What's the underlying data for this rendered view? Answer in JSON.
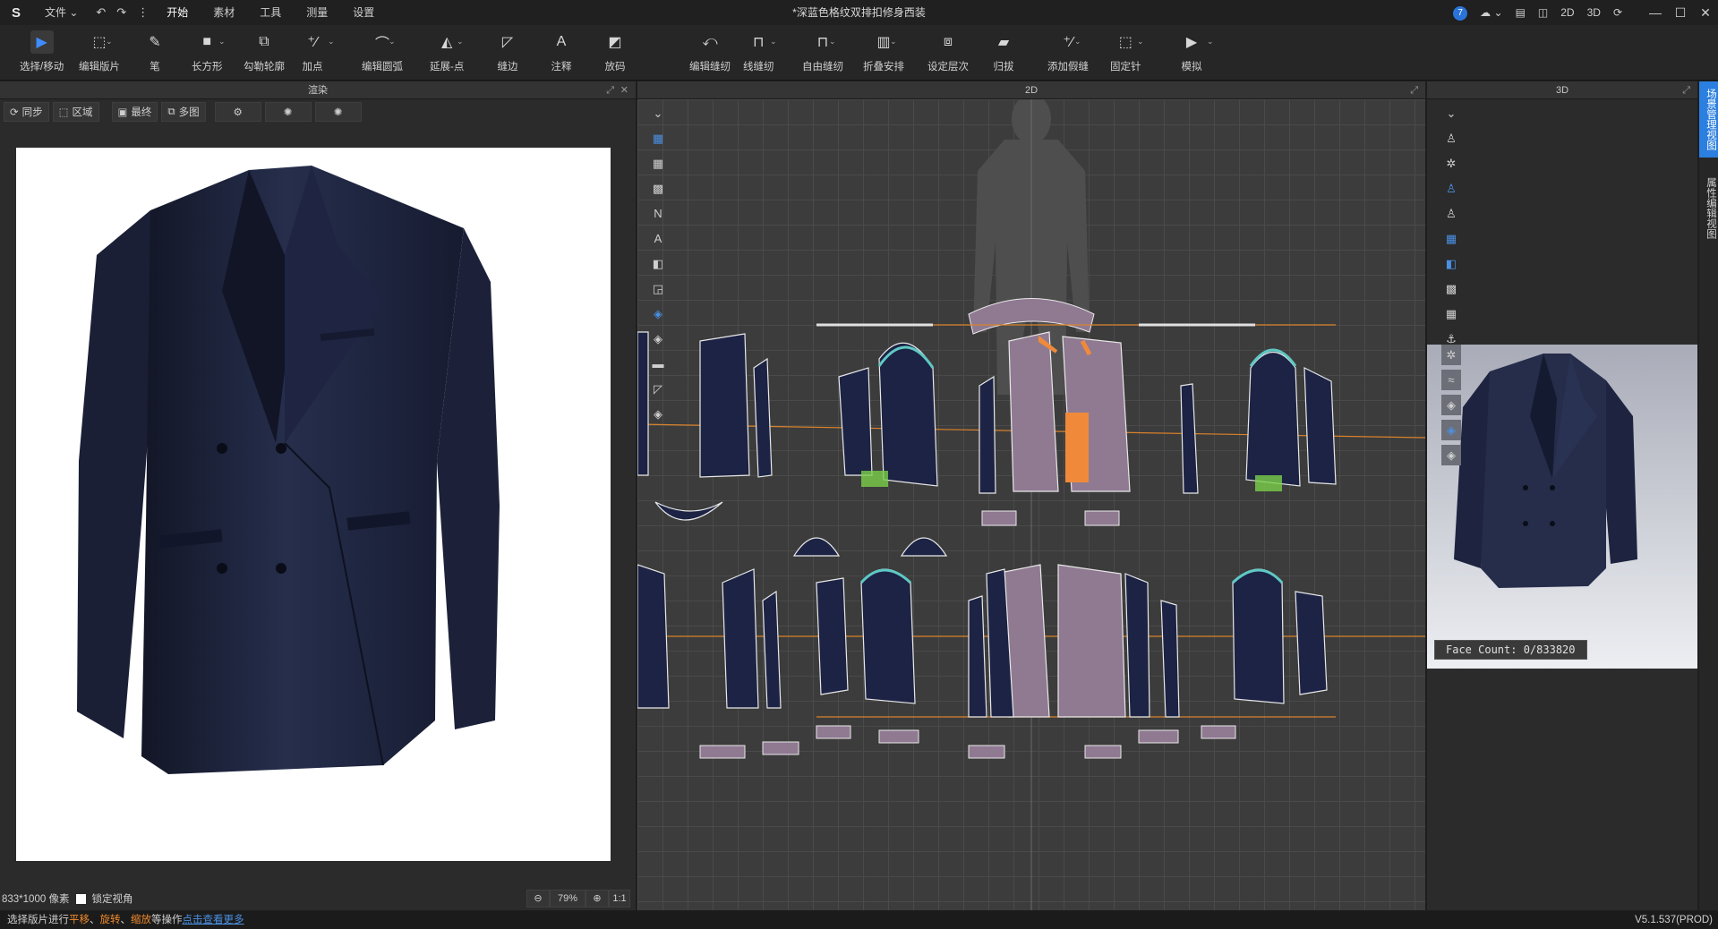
{
  "titlebar": {
    "logo": "S",
    "menu": [
      {
        "label": "文件 ⌄"
      },
      {
        "label": "开始",
        "active": true
      },
      {
        "label": "素材"
      },
      {
        "label": "工具"
      },
      {
        "label": "测量"
      },
      {
        "label": "设置"
      }
    ],
    "quick": [
      "↶",
      "↷",
      "⋮"
    ],
    "doc_title": "*深蓝色格纹双排扣修身西装",
    "right_items": [
      "7",
      "☁ ⌄",
      "▤",
      "◫",
      "2D",
      "3D",
      "⟳"
    ],
    "window_controls": [
      "—",
      "☐",
      "✕"
    ]
  },
  "toolbar": {
    "tools": [
      {
        "label": "选择/移动",
        "icon": "▶",
        "selected": true
      },
      {
        "label": "编辑版片",
        "icon": "⬚",
        "dd": true
      },
      {
        "label": "笔",
        "icon": "✎"
      },
      {
        "label": "长方形",
        "icon": "■",
        "dd": true
      },
      {
        "label": "勾勒轮廓",
        "icon": "⧉"
      },
      {
        "label": "加点",
        "icon": "⁺∕",
        "dd": true
      },
      {
        "label": "编辑圆弧",
        "icon": "⌒",
        "dd": true
      },
      {
        "label": "延展-点",
        "icon": "◭",
        "dd": true
      },
      {
        "label": "缝边",
        "icon": "◸"
      },
      {
        "label": "注释",
        "icon": "A"
      },
      {
        "label": "放码",
        "icon": "◩"
      },
      {
        "label": "编辑缝纫",
        "icon": "⤺"
      },
      {
        "label": "线缝纫",
        "icon": "⊓",
        "dd": true
      },
      {
        "label": "自由缝纫",
        "icon": "⊓",
        "dd": true
      },
      {
        "label": "折叠安排",
        "icon": "▥",
        "dd": true
      },
      {
        "label": "设定层次",
        "icon": "⧈"
      },
      {
        "label": "归拔",
        "icon": "▰"
      },
      {
        "label": "添加假缝",
        "icon": "⁺∕",
        "dd": true
      },
      {
        "label": "固定针",
        "icon": "⬚",
        "dd": true
      },
      {
        "label": "模拟",
        "icon": "▶",
        "dd": true
      }
    ]
  },
  "render_panel": {
    "title": "渲染",
    "buttons": [
      {
        "label": "同步",
        "icon": "⟳"
      },
      {
        "label": "区域",
        "icon": "⬚"
      },
      {
        "label": "最终",
        "icon": "▣"
      },
      {
        "label": "多图",
        "icon": "⧉"
      }
    ],
    "image_size": "833*1000 像素",
    "lock_label": "锁定视角",
    "zoom": "79%",
    "ratio": "1:1"
  },
  "panel_2d": {
    "title": "2D"
  },
  "panel_3d": {
    "title": "3D",
    "face_count": "Face Count: 0/833820"
  },
  "side_tabs": [
    "场景管理视图",
    "属性编辑视图"
  ],
  "status": {
    "prefix": "选择版片进行",
    "op1": "平移",
    "sep1": "、",
    "op2": "旋转",
    "sep2": "、",
    "op3": "缩放",
    "suffix": "等操作",
    "link": "点击查看更多",
    "version": "V5.1.537(PROD)"
  },
  "colors": {
    "accent": "#2b7fe0",
    "suit": "#1f2640",
    "pattern_fill": "#1c2344",
    "pattern_pink": "#8f7a92",
    "seam_orange": "#e07a2a"
  }
}
